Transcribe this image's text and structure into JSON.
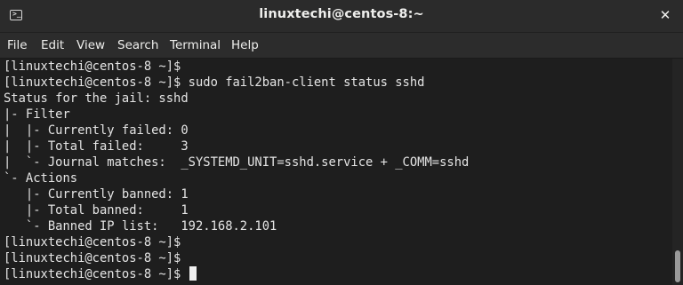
{
  "window": {
    "title": "linuxtechi@centos-8:~",
    "icon": "terminal-icon",
    "close_label": "✕"
  },
  "menubar": {
    "items": [
      "File",
      "Edit",
      "View",
      "Search",
      "Terminal",
      "Help"
    ]
  },
  "terminal": {
    "lines": [
      "[linuxtechi@centos-8 ~]$",
      "[linuxtechi@centos-8 ~]$ sudo fail2ban-client status sshd",
      "Status for the jail: sshd",
      "|- Filter",
      "|  |- Currently failed: 0",
      "|  |- Total failed:     3",
      "|  `- Journal matches:  _SYSTEMD_UNIT=sshd.service + _COMM=sshd",
      "`- Actions",
      "   |- Currently banned: 1",
      "   |- Total banned:     1",
      "   `- Banned IP list:   192.168.2.101",
      "[linuxtechi@centos-8 ~]$",
      "[linuxtechi@centos-8 ~]$",
      "[linuxtechi@centos-8 ~]$ "
    ]
  },
  "colors": {
    "titlebar": "#2b2b2b",
    "terminal_bg": "#1e1e1e",
    "terminal_fg": "#e4e4e4"
  }
}
